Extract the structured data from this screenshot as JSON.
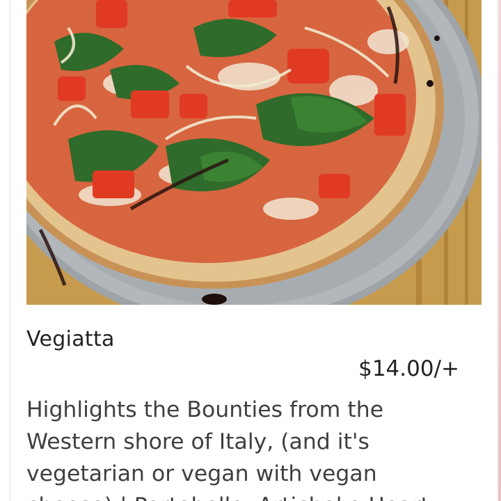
{
  "item": {
    "name": "Vegiatta",
    "price": "$14.00/+",
    "description_lines": [
      "Highlights the Bounties from the",
      "Western shore of Italy, (and it's",
      "vegetarian or vegan with vegan",
      "cheese) | Portobello, Artichoke Heart"
    ]
  },
  "image": {
    "subject-icon": "pizza-photo"
  },
  "colors": {
    "text_primary": "#222222",
    "text_secondary": "#3f3f3f",
    "background": "#ffffff"
  }
}
